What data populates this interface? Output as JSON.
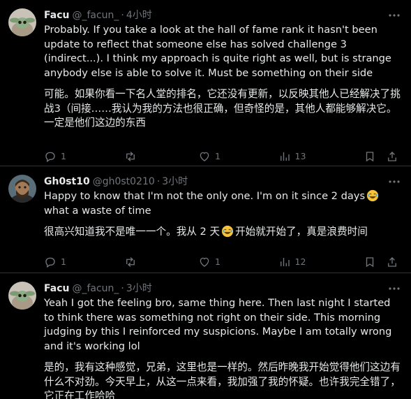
{
  "tweets": [
    {
      "name": "Facu",
      "handle": "@_facun_",
      "separator": "·",
      "time": "4小时",
      "text_en": "Probably. If you take a look at the hall of fame rank it hasn't been update to reflect that someone else has solved challenge 3 (indirect...). I think my approach is quite right as well, but is strange anybody else is able to solve it. Must be something on their side",
      "text_zh": "可能。如果你看一下名人堂的排名，它还没有更新，以反映其他人已经解决了挑战3（间接……我认为我的方法也很正确，但奇怪的是，其他人都能够解决它。一定是他们这边的东西",
      "replies": "1",
      "reposts": "",
      "likes": "1",
      "views": "13"
    },
    {
      "name": "Gh0st10",
      "handle": "@gh0st0210",
      "separator": "·",
      "time": "3小时",
      "text_en_before": "Happy to know that I'm not the only one. I'm on it since 2 days",
      "text_en_after": "what a waste of time",
      "text_zh_before": "很高兴知道我不是唯一一个。我从 2 天",
      "text_zh_after": "开始就开始了，真是浪费时间",
      "replies": "1",
      "reposts": "",
      "likes": "1",
      "views": "12"
    },
    {
      "name": "Facu",
      "handle": "@_facun_",
      "separator": "·",
      "time": "3小时",
      "text_en": "Yeah I got the feeling bro, same thing here. Then last night I started to think there was something not right on their side. This morning judging by this I reinforced my suspicions. Maybe I am totally wrong and it's working lol",
      "text_zh": "是的，我有这种感觉，兄弟，这里也是一样的。然后昨晚我开始觉得他们这边有什么不对劲。今天早上，从这一点来看，我加强了我的怀疑。也许我完全错了，它正在工作哈哈"
    }
  ],
  "colors": {
    "background": "#000000",
    "text": "#e7e9ea",
    "muted": "#71767b",
    "divider": "#2f3336"
  },
  "icons": [
    "reply-icon",
    "repost-icon",
    "like-icon",
    "views-icon",
    "bookmark-icon",
    "share-icon",
    "more-icon",
    "laughing-emoji"
  ]
}
